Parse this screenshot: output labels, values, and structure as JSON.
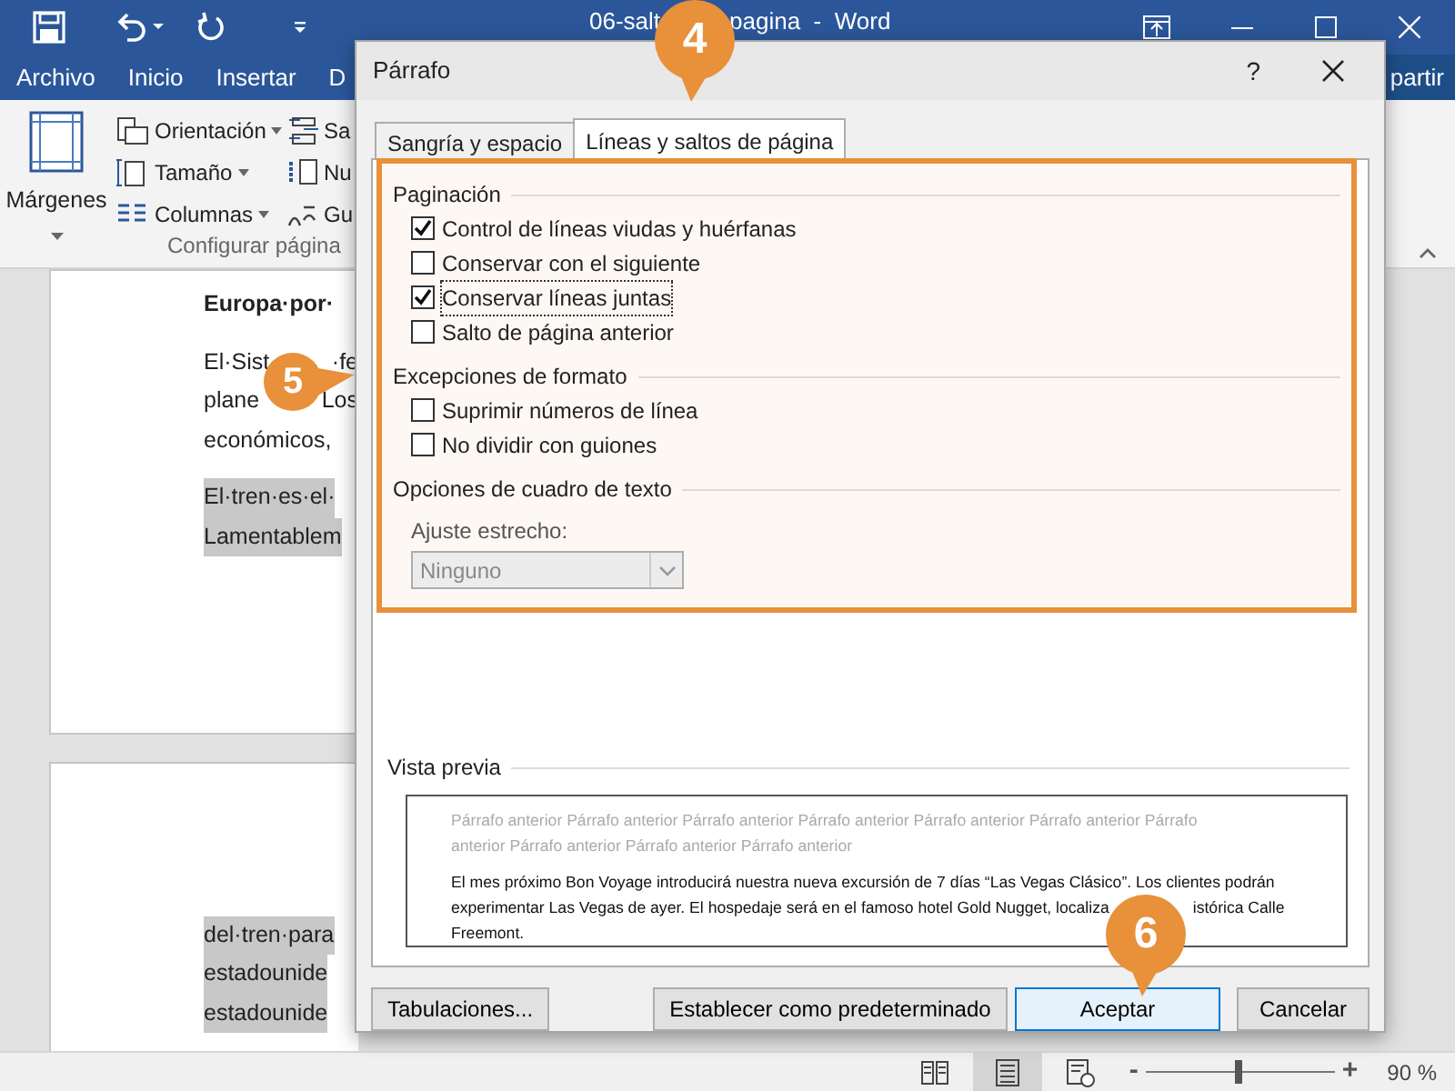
{
  "word": {
    "title_left": "06-salt",
    "title_right": "pagina  -  Word",
    "ribbon_tabs": [
      {
        "label": "Archivo",
        "kind": "tab"
      },
      {
        "label": "Inicio",
        "kind": "tab"
      },
      {
        "label": "Insertar",
        "kind": "tab"
      },
      {
        "label": "D",
        "kind": "tab"
      },
      {
        "label": "partir",
        "kind": "share"
      }
    ],
    "ribbon": {
      "margins_label": "Márgenes",
      "commands": [
        {
          "label": "Orientación",
          "kind": "orientation"
        },
        {
          "label": "Tamaño",
          "kind": "size"
        },
        {
          "label": "Columnas",
          "kind": "columns"
        }
      ],
      "more_commands": [
        {
          "label": "Sa",
          "kind": "breaks"
        },
        {
          "label": "Nu",
          "kind": "numbers"
        },
        {
          "label": "Gu",
          "kind": "hyphen"
        }
      ],
      "group_label": "Configurar página"
    },
    "document": {
      "pages": [
        {
          "paragraphs": [
            {
              "bold": true,
              "highlighted": false,
              "lines": [
                [
                  "Europa·por·"
                ]
              ]
            },
            {
              "bold": false,
              "highlighted": false,
              "lines": [
                [
                  "El·Sist",
                  "·fe"
                ],
                [
                  "plane",
                  "Los"
                ],
                [
                  "económicos,"
                ]
              ]
            },
            {
              "bold": false,
              "highlighted": true,
              "lines": [
                [
                  "El·tren·es·el·"
                ],
                [
                  "Lamentablem"
                ]
              ]
            }
          ]
        },
        {
          "paragraphs": [
            {
              "bold": false,
              "highlighted": true,
              "lines": [
                [
                  "del·tren·para"
                ],
                [
                  "estadounide"
                ],
                [
                  "estadounide"
                ]
              ]
            }
          ]
        }
      ]
    },
    "status_bar": {
      "views": [
        {
          "kind": "read",
          "selected": false
        },
        {
          "kind": "print",
          "selected": true
        },
        {
          "kind": "web",
          "selected": false
        }
      ],
      "zoom_minus": "-",
      "zoom_plus": "+",
      "zoom": {
        "level": 0.47
      },
      "zoom_text": "90 %"
    }
  },
  "dialog": {
    "title": "Párrafo",
    "help": "?",
    "tabs": [
      {
        "label": "Sangría y espacio",
        "selected": false
      },
      {
        "label": "Líneas y saltos de página",
        "selected": true
      }
    ],
    "panel_highlighted": true,
    "sections": [
      {
        "title": "Paginación",
        "checkboxes": [
          {
            "label": "Control de líneas viudas y huérfanas",
            "checked": true,
            "focused": false
          },
          {
            "label": "Conservar con el siguiente",
            "checked": false,
            "focused": false
          },
          {
            "label": "Conservar líneas juntas",
            "checked": true,
            "focused": true
          },
          {
            "label": "Salto de página anterior",
            "checked": false,
            "focused": false
          }
        ]
      },
      {
        "title": "Excepciones de formato",
        "checkboxes": [
          {
            "label": "Suprimir números de línea",
            "checked": false,
            "focused": false
          },
          {
            "label": "No dividir con guiones",
            "checked": false,
            "focused": false
          }
        ]
      },
      {
        "title": "Opciones de cuadro de texto",
        "field": {
          "label": "Ajuste estrecho:",
          "value": "Ninguno",
          "disabled": true
        }
      }
    ],
    "preview": {
      "title": "Vista previa",
      "previous_lines": [
        "Párrafo anterior Párrafo anterior Párrafo anterior Párrafo anterior Párrafo anterior Párrafo anterior Párrafo",
        "anterior Párrafo anterior Párrafo anterior Párrafo anterior"
      ],
      "current_lines": [
        [
          "El mes próximo Bon Voyage introducirá nuestra nueva excursión de 7 días “Las Vegas Clásico”. Los clientes podrán"
        ],
        [
          "experimentar Las Vegas de ayer. El hospedaje será en el famoso hotel Gold Nugget, localiza",
          "istórica Calle"
        ],
        [
          "Freemont."
        ]
      ]
    },
    "buttons": [
      {
        "label": "Tabulaciones...",
        "default": false
      },
      {
        "label": "Establecer como predeterminado",
        "default": false
      },
      {
        "label": "Aceptar",
        "default": true
      },
      {
        "label": "Cancelar",
        "default": false
      }
    ]
  },
  "callouts": [
    {
      "label": "4",
      "kind": "down"
    },
    {
      "label": "5",
      "kind": "right"
    },
    {
      "label": "6",
      "kind": "down"
    }
  ]
}
